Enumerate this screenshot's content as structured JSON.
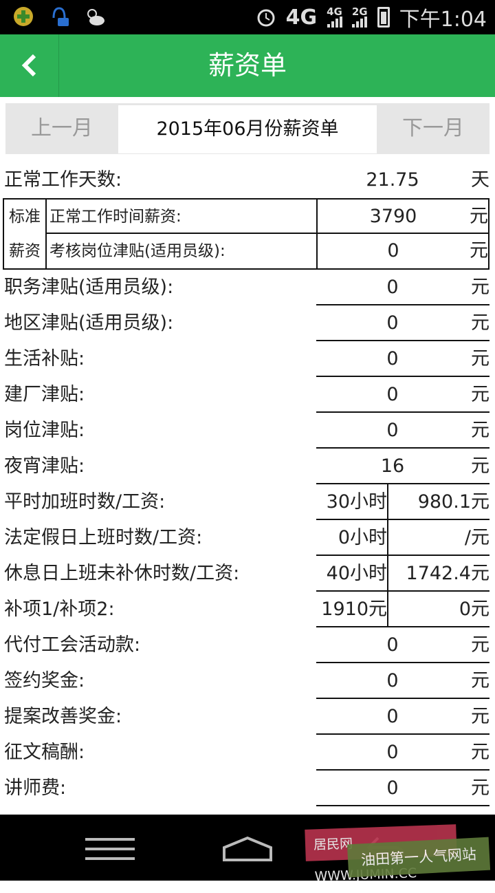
{
  "status_bar": {
    "network": "4G",
    "sim1": "4G",
    "sim2": "2G",
    "time": "下午1:04"
  },
  "title": "薪资单",
  "month_nav": {
    "prev": "上一月",
    "current": "2015年06月份薪资单",
    "next": "下一月"
  },
  "work_days": {
    "label": "正常工作天数:",
    "value": "21.75",
    "unit": "天"
  },
  "standard": {
    "side_1": "标准",
    "side_2": "薪资",
    "items": [
      {
        "label": "正常工作时间薪资:",
        "value": "3790",
        "unit": "元"
      },
      {
        "label": "考核岗位津贴(适用员级):",
        "value": "0",
        "unit": "元"
      }
    ]
  },
  "rows": [
    {
      "label": "职务津贴(适用员级):",
      "value": "0",
      "unit": "元"
    },
    {
      "label": "地区津贴(适用员级):",
      "value": "0",
      "unit": "元"
    },
    {
      "label": "生活补贴:",
      "value": "0",
      "unit": "元"
    },
    {
      "label": "建厂津贴:",
      "value": "0",
      "unit": "元"
    },
    {
      "label": "岗位津贴:",
      "value": "0",
      "unit": "元"
    },
    {
      "label": "夜宵津贴:",
      "value": "16",
      "unit": "元"
    }
  ],
  "pair_rows": [
    {
      "label": "平时加班时数/工资:",
      "v1": "30小时",
      "v2": "980.1元"
    },
    {
      "label": "法定假日上班时数/工资:",
      "v1": "0小时",
      "v2": "/元"
    },
    {
      "label": "休息日上班未补休时数/工资:",
      "v1": "40小时",
      "v2": "1742.4元"
    },
    {
      "label": "补项1/补项2:",
      "v1": "1910元",
      "v2": "0元"
    }
  ],
  "rows_bottom": [
    {
      "label": "代付工会活动款:",
      "value": "0",
      "unit": "元"
    },
    {
      "label": "签约奖金:",
      "value": "0",
      "unit": "元"
    },
    {
      "label": "提案改善奖金:",
      "value": "0",
      "unit": "元"
    },
    {
      "label": "征文稿酬:",
      "value": "0",
      "unit": "元"
    },
    {
      "label": "讲师费:",
      "value": "0",
      "unit": "元"
    }
  ],
  "watermark": {
    "line1": "居民网 WWW.JUMIN.CC",
    "line2": "油田第一人气网站"
  },
  "colors": {
    "titlebar": "#2db357",
    "month_bar": "#e6e6e6"
  }
}
